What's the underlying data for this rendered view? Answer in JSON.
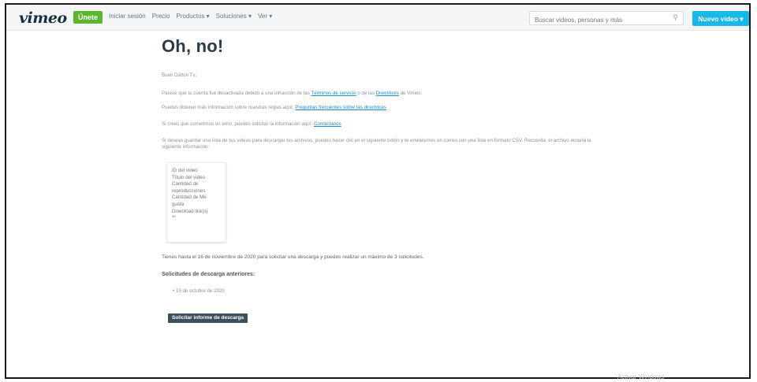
{
  "header": {
    "logo": "vimeo",
    "join_label": "Únete",
    "nav": [
      "Iniciar sesión",
      "Precio",
      "Productos ▾",
      "Soluciones ▾",
      "Ver ▾"
    ],
    "search_placeholder": "Buscar videos, personas y más",
    "new_video_label": "Nuevo video ▾"
  },
  "main": {
    "title": "Oh, no!",
    "greeting": "Buen Dalton Tv:",
    "p1_before": "Parece que tu cuenta fue desactivada debido a una infracción de las ",
    "p1_link1": "Términos de servicio",
    "p1_middle": " o de las ",
    "p1_link2": "Directrices",
    "p1_after": " de Vimeo.",
    "p2_before": "Puedes obtener más información sobre nuestras reglas aquí: ",
    "p2_link": "Preguntas frecuentes sobre las directrices",
    "p3_before": "Si crees que cometimos un error, puedes solicitar la información aquí: ",
    "p3_link": "Contáctanos",
    "p4": "Si deseas guardar una lista de tus videos para descargar tus archivos, puedes hacer clic en el siguiente botón y te enviaremos un correo con una lista en formato CSV. Recuerda: el archivo incluirá la siguiente información:",
    "fields": [
      "ID del video",
      "Título del video",
      "Cantidad de",
      "reproducciones",
      "Cantidad de Me",
      "gusta",
      "Download link(s)",
      "**"
    ],
    "p5": "Tienes hasta el 16 de noviembre de 2020 para solicitar una descarga y puedes realizar un máximo de 3 solicitudes.",
    "previous_title": "Solicitudes de descarga anteriores:",
    "previous_items": [
      "15 de octubre de 2020"
    ],
    "request_button": "Solicitar informe de descarga"
  },
  "footer": {
    "watermark": "Activar Windows"
  }
}
